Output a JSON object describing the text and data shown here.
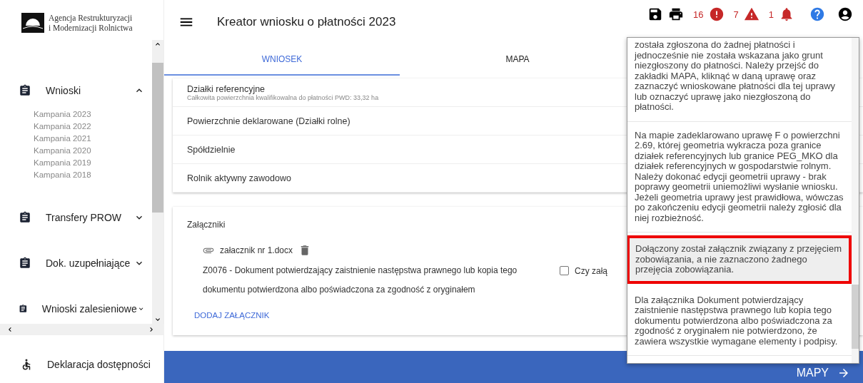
{
  "sidebar": {
    "logo_text": [
      "Agencja Restrukturyzacji",
      "i Modernizacji Rolnictwa"
    ],
    "menu": [
      {
        "label": "Wnioski",
        "expanded": true,
        "children": [
          {
            "label": "Kampania 2023"
          },
          {
            "label": "Kampania 2022"
          },
          {
            "label": "Kampania 2021"
          },
          {
            "label": "Kampania 2020"
          },
          {
            "label": "Kampania 2019"
          },
          {
            "label": "Kampania 2018"
          }
        ]
      },
      {
        "label": "Transfery PROW",
        "expanded": false
      },
      {
        "label": "Dok. uzupełniające",
        "expanded": false
      },
      {
        "label": "Wnioski zalesieniowe",
        "expanded": false
      }
    ],
    "footer_link": "Deklaracja dostępności"
  },
  "header": {
    "title": "Kreator wniosku o płatności 2023",
    "counters": [
      {
        "kind": "error",
        "count": "16"
      },
      {
        "kind": "warning",
        "count": "7"
      },
      {
        "kind": "notification",
        "count": "1"
      }
    ]
  },
  "tabs": [
    {
      "label": "WNIOSEK",
      "selected": true
    },
    {
      "label": "MAPA",
      "selected": false
    }
  ],
  "sections": [
    {
      "title": "Działki referencyjne",
      "subtitle": "Całkowita powierzchnia kwalifikowalna do płatności PWD: 33,32 ha"
    },
    {
      "title": "Powierzchnie deklarowane (Działki rolne)"
    },
    {
      "title": "Spółdzielnie"
    },
    {
      "title": "Rolnik aktywny zawodowo"
    }
  ],
  "attachments": {
    "title": "Załączniki",
    "files": [
      {
        "name": "załacznik nr 1.docx",
        "description": "Z0076 - Dokument potwierdzający zaistnienie następstwa prawnego lub kopia tego dokumentu potwierdzona albo poświadczona za zgodność z oryginałem",
        "checkbox_label": "Czy załą",
        "checked": false
      }
    ],
    "add_button": "DODAJ ZAŁĄCZNIK"
  },
  "bottom_bar": {
    "button": "MAPY"
  },
  "messages": [
    {
      "text": "została zgłoszona do żadnej płatności i jednocześnie nie została wskazana jako grunt niezgłoszony do płatności. Należy przejść do zakładki MAPA, kliknąć w daną uprawę oraz zaznaczyć wnioskowane płatności dla tej uprawy lub oznaczyć uprawę jako niezgłoszoną do płatności.",
      "selected": false
    },
    {
      "text": "Na mapie zadeklarowano uprawę F o powierzchni 2.69, której geometria wykracza poza granice działek referencyjnych lub granice PEG_MKO dla działek referencyjnych w gospodarstwie rolnym. Należy dokonać edycji geometrii uprawy - brak poprawy geometrii uniemożliwi wysłanie wniosku. Jeżeli geometria uprawy jest prawidłowa, wówczas po zakończeniu edycji geometrii należy zgłosić dla niej rozbieżność.",
      "selected": false
    },
    {
      "text": "Dołączony został załącznik związany z przejęciem zobowiązania, a nie zaznaczono żadnego przejęcia zobowiązania.",
      "selected": true
    },
    {
      "text": "Dla załącznika Dokument potwierdzający zaistnienie następstwa prawnego lub kopia tego dokumentu potwierdzona albo poświadczona za zgodność z oryginałem nie potwierdzono, że zawiera wszystkie wymagane elementy i podpisy.",
      "selected": false
    }
  ]
}
